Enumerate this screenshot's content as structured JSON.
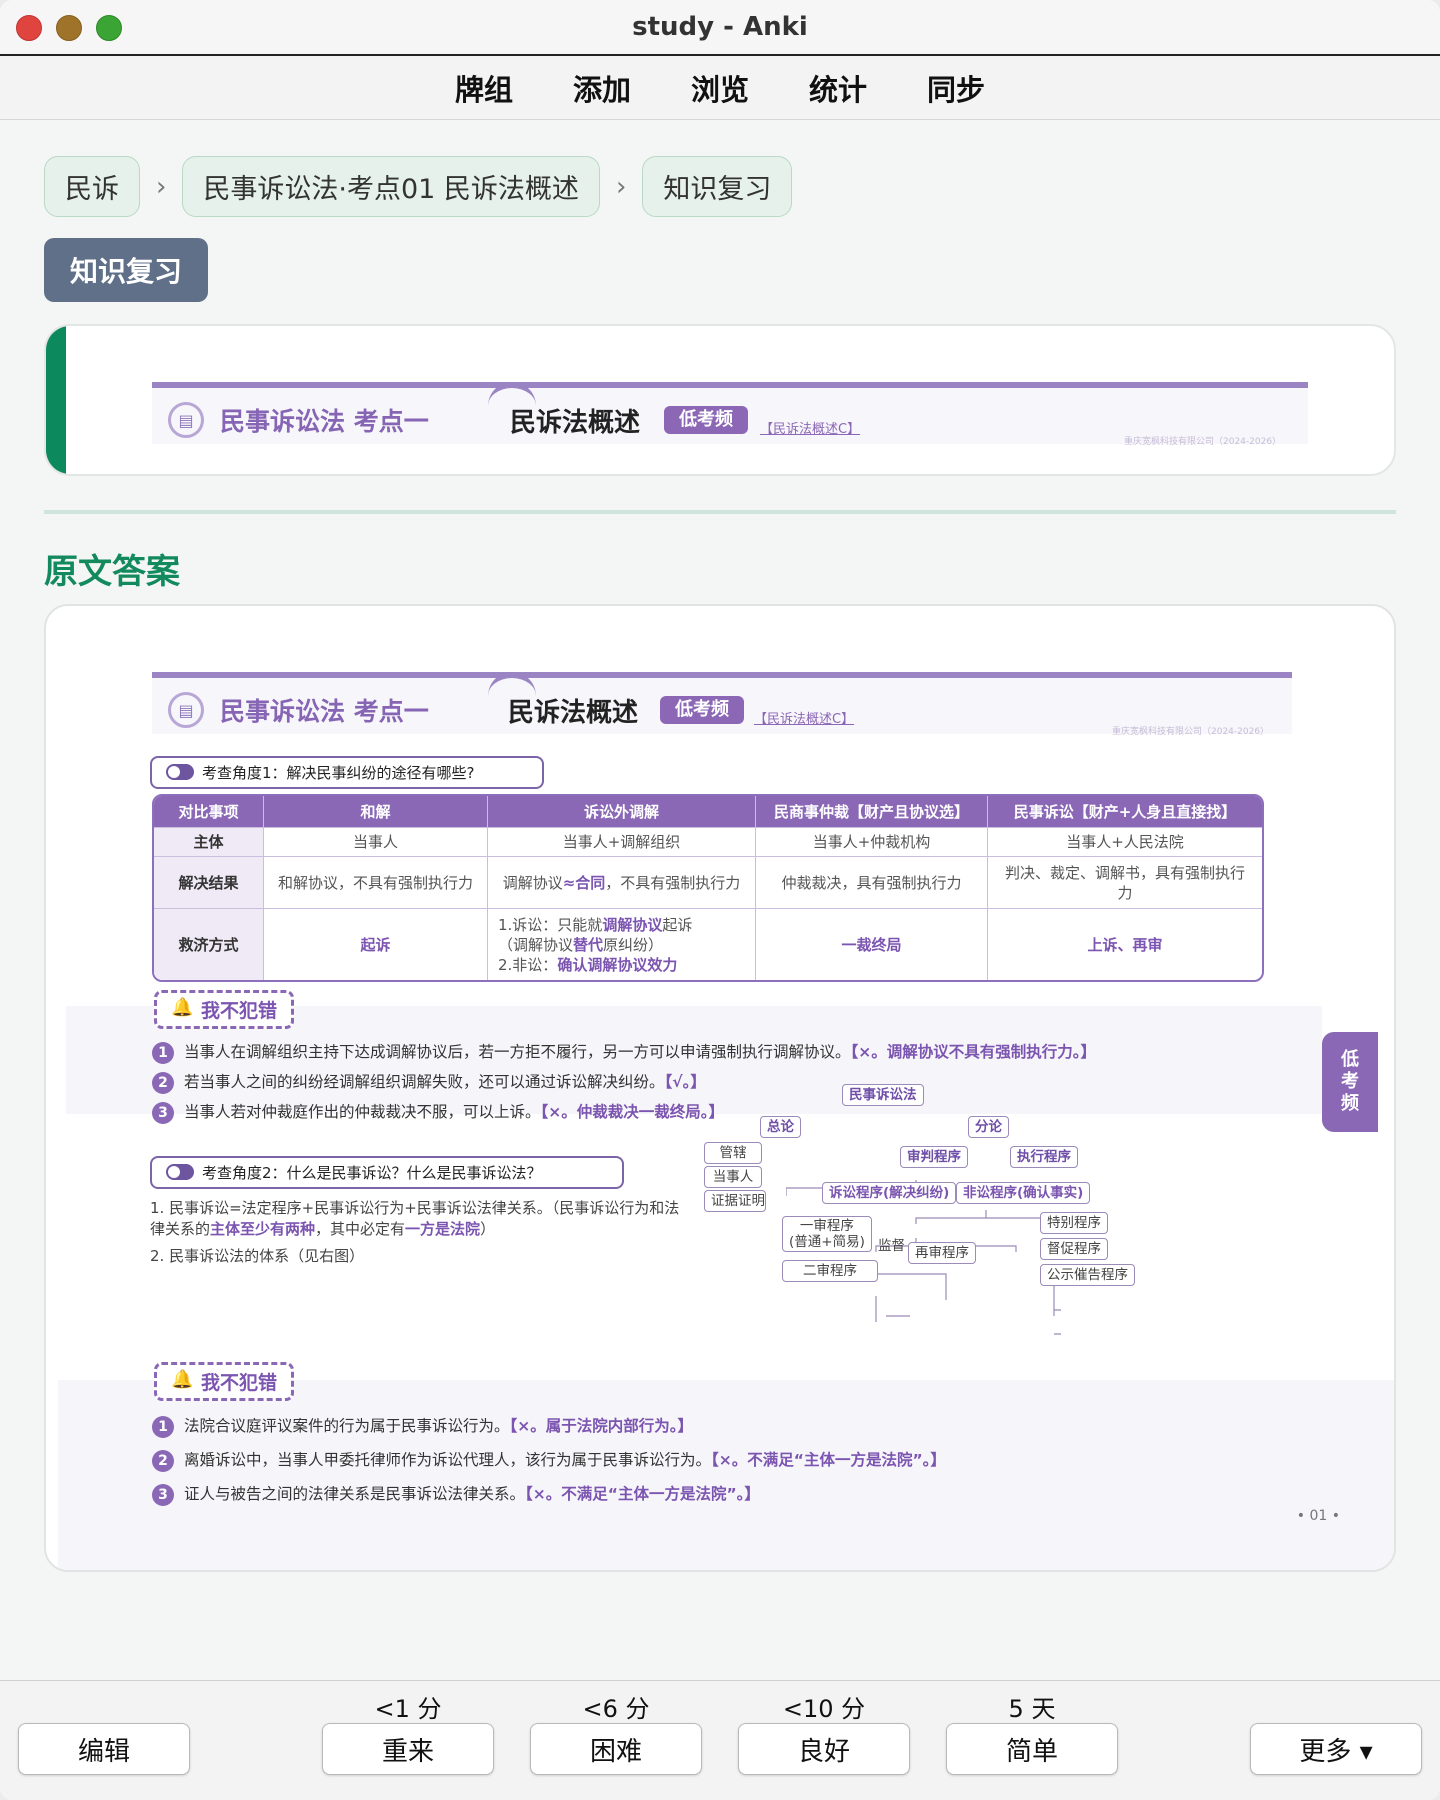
{
  "window": {
    "title": "study - Anki"
  },
  "toolbar": {
    "items": [
      "牌组",
      "添加",
      "浏览",
      "统计",
      "同步"
    ]
  },
  "breadcrumb": {
    "items": [
      "民诉",
      "民事诉讼法·考点01 民诉法概述",
      "知识复习"
    ],
    "separator": "›"
  },
  "badge": "知识复习",
  "banner": {
    "left": "民事诉讼法 考点一",
    "main": "民诉法概述",
    "tag": "低考频",
    "link": "【民诉法概述C】",
    "copyright": "重庆宽枫科技有限公司（2024-2026）"
  },
  "section_title": "原文答案",
  "angle1": "考查角度1：解决民事纠纷的途径有哪些?",
  "table": {
    "headers": [
      "对比事项",
      "和解",
      "诉讼外调解",
      "民商事仲裁【财产且协议选】",
      "民事诉讼【财产+人身且直接找】"
    ],
    "row1": {
      "label": "主体",
      "c1": "当事人",
      "c2": "当事人+调解组织",
      "c3": "当事人+仲裁机构",
      "c4": "当事人+人民法院"
    },
    "row2": {
      "label": "解决结果",
      "c1": "和解协议，不具有强制执行力",
      "c2a": "调解协议",
      "c2b": "≈合同",
      "c2c": "，不具有强制执行力",
      "c3": "仲裁裁决，具有强制执行力",
      "c4": "判决、裁定、调解书，具有强制执行力"
    },
    "row3": {
      "label": "救济方式",
      "c1": "起诉",
      "c2_l1a": "1.诉讼：只能就",
      "c2_l1b": "调解协议",
      "c2_l1c": "起诉",
      "c2_l2a": "（调解协议",
      "c2_l2b": "替代",
      "c2_l2c": "原纠纷）",
      "c2_l3a": "2.非讼：",
      "c2_l3b": "确认调解协议效力",
      "c3": "一裁终局",
      "c4": "上诉、再审"
    }
  },
  "mistake_label": "我不犯错",
  "mistakes1": [
    {
      "n": "1",
      "q": "当事人在调解组织主持下达成调解协议后，若一方拒不履行，另一方可以申请强制执行调解协议。",
      "a": "【×。调解协议不具有强制执行力。】"
    },
    {
      "n": "2",
      "q": "若当事人之间的纠纷经调解组织调解失败，还可以通过诉讼解决纠纷。",
      "a": "【√。】"
    },
    {
      "n": "3",
      "q": "当事人若对仲裁庭作出的仲裁裁决不服，可以上诉。",
      "a": "【×。仲裁裁决一裁终局。】"
    }
  ],
  "side_tab": [
    "低",
    "考",
    "频"
  ],
  "angle2": "考查角度2：什么是民事诉讼？什么是民事诉讼法？",
  "para": {
    "p1a": "1. 民事诉讼=法定程序+民事诉讼行为+民事诉讼法律关系。（民事诉讼行为和法",
    "p1b": "律关系的",
    "p1c": "主体至少有两种",
    "p1d": "，其中必定有",
    "p1e": "一方是法院",
    "p1f": "）",
    "p2": "2. 民事诉讼法的体系（见右图）"
  },
  "tree": {
    "root": "民事诉讼法",
    "general": "总论",
    "special": "分论",
    "g1": "管辖",
    "g2": "当事人",
    "g3": "证据证明",
    "trial": "审判程序",
    "exec": "执行程序",
    "litig": "诉讼程序(解决纠纷)",
    "nonlitig": "非讼程序(确认事实)",
    "first1": "一审程序",
    "first2": "(普通+简易)",
    "second": "二审程序",
    "supervise": "监督",
    "retrial": "再审程序",
    "n1": "特别程序",
    "n2": "督促程序",
    "n3": "公示催告程序"
  },
  "mistakes2": [
    {
      "n": "1",
      "q": "法院合议庭评议案件的行为属于民事诉讼行为。",
      "a": "【×。属于法院内部行为。】"
    },
    {
      "n": "2",
      "q": "离婚诉讼中，当事人甲委托律师作为诉讼代理人，该行为属于民事诉讼行为。",
      "a": "【×。不满足“主体一方是法院”。】"
    },
    {
      "n": "3",
      "q": "证人与被告之间的法律关系是民事诉讼法律关系。",
      "a": "【×。不满足“主体一方是法院”。】"
    }
  ],
  "page_no": "• 01 •",
  "bottom": {
    "edit": "编辑",
    "again": "重来",
    "hard": "困难",
    "good": "良好",
    "easy": "简单",
    "more": "更多 ▾",
    "again_iv": "<1 分",
    "hard_iv": "<6 分",
    "good_iv": "<10 分",
    "easy_iv": "5 天"
  }
}
